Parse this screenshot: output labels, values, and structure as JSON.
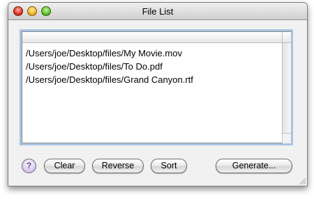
{
  "window": {
    "title": "File List"
  },
  "file_list": {
    "rows": [
      "/Users/joe/Desktop/files/My Movie.mov",
      "/Users/joe/Desktop/files/To Do.pdf",
      "/Users/joe/Desktop/files/Grand Canyon.rtf"
    ]
  },
  "buttons": {
    "help": "?",
    "clear": "Clear",
    "reverse": "Reverse",
    "sort": "Sort",
    "generate": "Generate..."
  }
}
